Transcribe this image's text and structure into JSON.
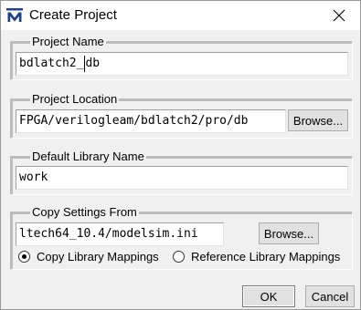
{
  "window": {
    "title": "Create Project",
    "app_icon": "modelsim-icon",
    "close_icon": "close-icon"
  },
  "project_name": {
    "label": "Project Name",
    "value_before_cursor": "bdlatch2_",
    "value_after_cursor": "db"
  },
  "project_location": {
    "label": "Project Location",
    "value": "FPGA/verilogleam/bdlatch2/pro/db",
    "browse_label": "Browse..."
  },
  "default_library": {
    "label": "Default Library Name",
    "value": "work"
  },
  "copy_settings": {
    "label": "Copy Settings From",
    "value": "ltech64_10.4/modelsim.ini",
    "browse_label": "Browse...",
    "options": [
      {
        "label": "Copy Library Mappings",
        "selected": true
      },
      {
        "label": "Reference Library Mappings",
        "selected": false
      }
    ]
  },
  "footer": {
    "ok_label": "OK",
    "cancel_label": "Cancel"
  }
}
